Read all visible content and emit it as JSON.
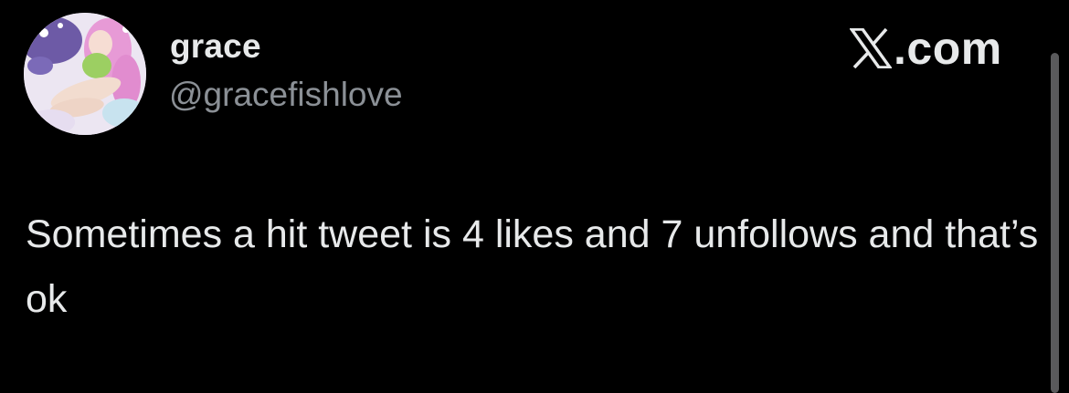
{
  "author": {
    "display_name": "grace",
    "handle": "@gracefishlove",
    "avatar_icon": "anime-avatar-icon"
  },
  "brand": {
    "logo_icon": "x-logo-icon",
    "text": ".com"
  },
  "tweet": {
    "text": "Sometimes a hit tweet is 4 likes and 7 unfollows and that’s ok"
  },
  "colors": {
    "background": "#000000",
    "primary_text": "#e7e9ea",
    "secondary_text": "#8b9096"
  }
}
